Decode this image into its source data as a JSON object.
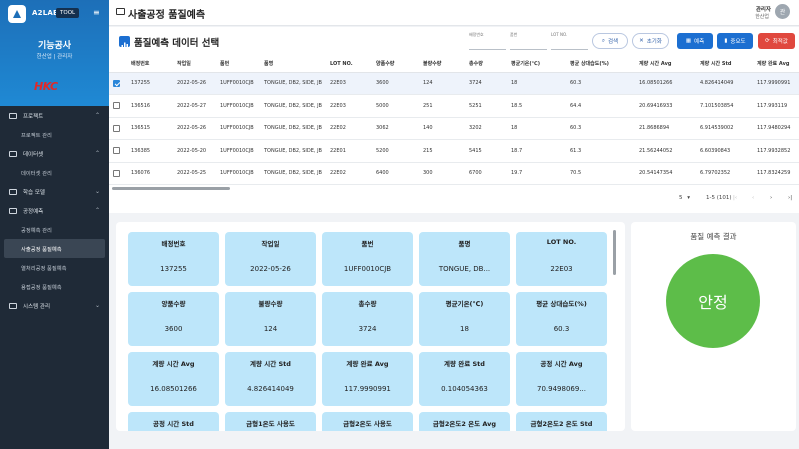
{
  "sidebar": {
    "brand": "A2LAB",
    "tool_badge": "TOOL",
    "menu_glyph": "≡",
    "company": "기능공사",
    "user_line": "한산업 | 관리자",
    "company_logo": "HKC",
    "groups": [
      {
        "label": "프로젝트",
        "items": [
          "프로젝트 관리"
        ]
      },
      {
        "label": "데이터셋",
        "items": [
          "데이터셋 관리"
        ]
      },
      {
        "label": "학습 모델",
        "items": []
      },
      {
        "label": "공정예측",
        "items": [
          "공정예측 관리",
          "사출공정 품질예측",
          "열처리공정 품질예측",
          "용접공정 품질예측"
        ]
      },
      {
        "label": "시스템 관리",
        "items": []
      }
    ]
  },
  "header": {
    "title": "사출공정 품질예측",
    "user_name": "관리자",
    "user_id": "한산업",
    "avatar_text": "관"
  },
  "selection": {
    "title": "품질예측 데이터 선택",
    "filters": [
      {
        "label": "배정번호",
        "value": ""
      },
      {
        "label": "품번",
        "value": ""
      },
      {
        "label": "LOT NO.",
        "value": ""
      }
    ],
    "buttons": {
      "search": "검색",
      "reset": "초기화",
      "predict": "예측",
      "importance": "중요도",
      "optimize": "최적값"
    },
    "columns": [
      "배정번호",
      "작업일",
      "품번",
      "품명",
      "LOT NO.",
      "양품수량",
      "불량수량",
      "총수량",
      "평균기온(℃)",
      "평균 상대습도(%)",
      "계량 시간 Avg",
      "계량 시간 Std",
      "계량 완료 Avg"
    ],
    "rows": [
      {
        "checked": true,
        "cells": [
          "137255",
          "2022-05-26",
          "1UFF0010CJB",
          "TONGUE, DB2, SIDE, JB",
          "22E03",
          "3600",
          "124",
          "3724",
          "18",
          "60.3",
          "16.08501266",
          "4.826414049",
          "117.9990991"
        ]
      },
      {
        "checked": false,
        "cells": [
          "136516",
          "2022-05-27",
          "1UFF0010CJB",
          "TONGUE, DB2, SIDE, JB",
          "22E03",
          "5000",
          "251",
          "5251",
          "18.5",
          "64.4",
          "20.69416933",
          "7.101503854",
          "117.993119"
        ]
      },
      {
        "checked": false,
        "cells": [
          "136515",
          "2022-05-26",
          "1UFF0010CJB",
          "TONGUE, DB2, SIDE, JB",
          "22E02",
          "3062",
          "140",
          "3202",
          "18",
          "60.3",
          "21.8686894",
          "6.914539002",
          "117.9480294"
        ]
      },
      {
        "checked": false,
        "cells": [
          "136385",
          "2022-05-20",
          "1UFF0010CJB",
          "TONGUE, DB2, SIDE, JB",
          "22E01",
          "5200",
          "215",
          "5415",
          "18.7",
          "61.3",
          "21.56244052",
          "6.60390843",
          "117.9932852"
        ]
      },
      {
        "checked": false,
        "cells": [
          "136076",
          "2022-05-25",
          "1UFF0010CJB",
          "TONGUE, DB2, SIDE, JB",
          "22E02",
          "6400",
          "300",
          "6700",
          "19.7",
          "70.5",
          "20.54147354",
          "6.79702352",
          "117.8324259"
        ]
      }
    ],
    "pager": {
      "page_size": "5",
      "range": "1-5 (101)"
    }
  },
  "detail": {
    "tiles": [
      {
        "label": "배정번호",
        "value": "137255"
      },
      {
        "label": "작업일",
        "value": "2022-05-26"
      },
      {
        "label": "품번",
        "value": "1UFF0010CJB"
      },
      {
        "label": "품명",
        "value": "TONGUE, DB..."
      },
      {
        "label": "LOT NO.",
        "value": "22E03"
      },
      {
        "label": "양품수량",
        "value": "3600"
      },
      {
        "label": "불량수량",
        "value": "124"
      },
      {
        "label": "총수량",
        "value": "3724"
      },
      {
        "label": "평균기온(℃)",
        "value": "18"
      },
      {
        "label": "평균 상대습도(%)",
        "value": "60.3"
      },
      {
        "label": "계량 시간 Avg",
        "value": "16.08501266"
      },
      {
        "label": "계량 시간 Std",
        "value": "4.826414049"
      },
      {
        "label": "계량 완료 Avg",
        "value": "117.9990991"
      },
      {
        "label": "계량 완료 Std",
        "value": "0.104054363"
      },
      {
        "label": "공정 시간 Avg",
        "value": "70.9498069..."
      },
      {
        "label": "공정 시간 Std",
        "value": ""
      },
      {
        "label": "금형1온도 사용도",
        "value": ""
      },
      {
        "label": "금형2온도 사용도",
        "value": ""
      },
      {
        "label": "금형2온도2 온도 Avg",
        "value": ""
      },
      {
        "label": "금형2온도2 온도 Std",
        "value": ""
      }
    ]
  },
  "result": {
    "title": "품질 예측 결과",
    "value": "안정",
    "color": "#5dbd49"
  },
  "colors": {
    "primary": "#1c6fd1",
    "danger": "#e0483e",
    "sidebar": "#1f2a37",
    "tile": "#bde6fa"
  }
}
